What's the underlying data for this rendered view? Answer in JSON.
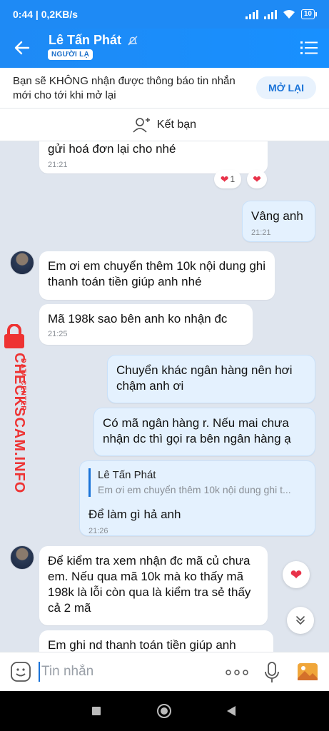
{
  "status_bar": {
    "time": "0:44",
    "speed": "0,2KB/s",
    "battery": "10"
  },
  "header": {
    "name": "Lê Tấn Phát",
    "badge": "NGƯỜI LẠ"
  },
  "notice": {
    "text": "Bạn sẽ KHÔNG nhận được thông báo tin nhắn mới cho tới khi mở lại",
    "button": "MỞ LẠI"
  },
  "add_friend": {
    "label": "Kết bạn"
  },
  "watermark": {
    "main": "CHECKSCAM.INFO",
    "sub": "DATA CENTER"
  },
  "messages": {
    "m1": {
      "text": "gửi hoá đơn lại cho nhé",
      "time": "21:21",
      "reaction_count": "1"
    },
    "m2": {
      "text": "Vâng anh",
      "time": "21:21"
    },
    "m3": {
      "text": "Em ơi em chuyển thêm 10k nội dung ghi thanh toán tiền giúp anh nhé"
    },
    "m4": {
      "text": "Mã 198k sao bên anh ko nhận đc",
      "time": "21:25"
    },
    "m5": {
      "text": "Chuyển khác ngân hàng nên hơi chậm anh ơi"
    },
    "m6": {
      "text": "Có mã ngân hàng r. Nếu mai chưa nhận dc thì gọi ra bên ngân hàng ạ"
    },
    "m7": {
      "quote_name": "Lê Tấn Phát",
      "quote_text": "Em ơi em chuyển thêm 10k nội dung ghi t...",
      "text": "Để làm gì hả anh",
      "time": "21:26"
    },
    "m8": {
      "text": "Để kiểm tra xem nhận đc mã củ chưa em. Nếu qua mã 10k mà ko thấy mã 198k là lỗi còn qua là kiểm tra sẻ thấy cả 2 mã"
    },
    "m9": {
      "text": "Em ghi nd thanh toán tiền giúp anh"
    }
  },
  "input": {
    "placeholder": "Tin nhắn"
  },
  "colors": {
    "primary": "#1e8af5",
    "heart": "#e8334a",
    "watermark": "#ee3333"
  },
  "icons": [
    "back-arrow-icon",
    "mute-bell-icon",
    "menu-icon",
    "add-user-icon",
    "heart-icon",
    "scroll-down-icon",
    "sticker-icon",
    "more-icon",
    "mic-icon",
    "image-icon"
  ]
}
